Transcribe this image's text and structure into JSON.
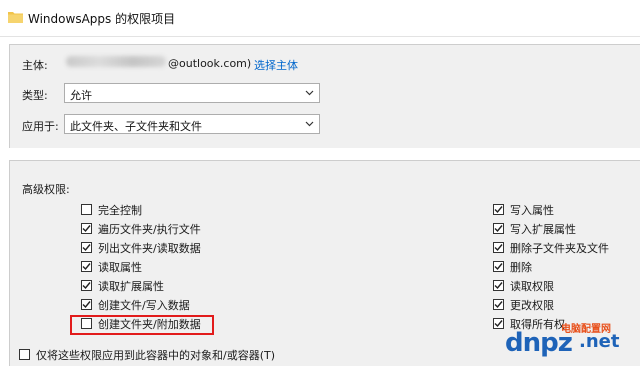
{
  "window": {
    "title": "WindowsApps 的权限项目",
    "icon": "folder-icon"
  },
  "principal": {
    "label": "主体:",
    "email_suffix": "@outlook.com)",
    "select_link": "选择主体"
  },
  "type": {
    "label": "类型:",
    "value": "允许"
  },
  "applies_to": {
    "label": "应用于:",
    "value": "此文件夹、子文件夹和文件"
  },
  "advanced": {
    "heading": "高级权限:",
    "left_permissions": [
      {
        "label": "完全控制",
        "checked": false
      },
      {
        "label": "遍历文件夹/执行文件",
        "checked": true
      },
      {
        "label": "列出文件夹/读取数据",
        "checked": true
      },
      {
        "label": "读取属性",
        "checked": true
      },
      {
        "label": "读取扩展属性",
        "checked": true
      },
      {
        "label": "创建文件/写入数据",
        "checked": true
      },
      {
        "label": "创建文件夹/附加数据",
        "checked": false
      }
    ],
    "right_permissions": [
      {
        "label": "写入属性",
        "checked": true
      },
      {
        "label": "写入扩展属性",
        "checked": true
      },
      {
        "label": "删除子文件夹及文件",
        "checked": true
      },
      {
        "label": "删除",
        "checked": true
      },
      {
        "label": "读取权限",
        "checked": true
      },
      {
        "label": "更改权限",
        "checked": true
      },
      {
        "label": "取得所有权",
        "checked": true
      }
    ]
  },
  "apply_only": {
    "label": "仅将这些权限应用到此容器中的对象和/或容器(T)",
    "checked": false
  },
  "watermark": {
    "main": "dnpz",
    "net": ".net",
    "sub": "电脑配置网"
  },
  "colors": {
    "link": "#0066cc",
    "highlight": "#e21b1b",
    "panel": "#f0f0f0"
  }
}
